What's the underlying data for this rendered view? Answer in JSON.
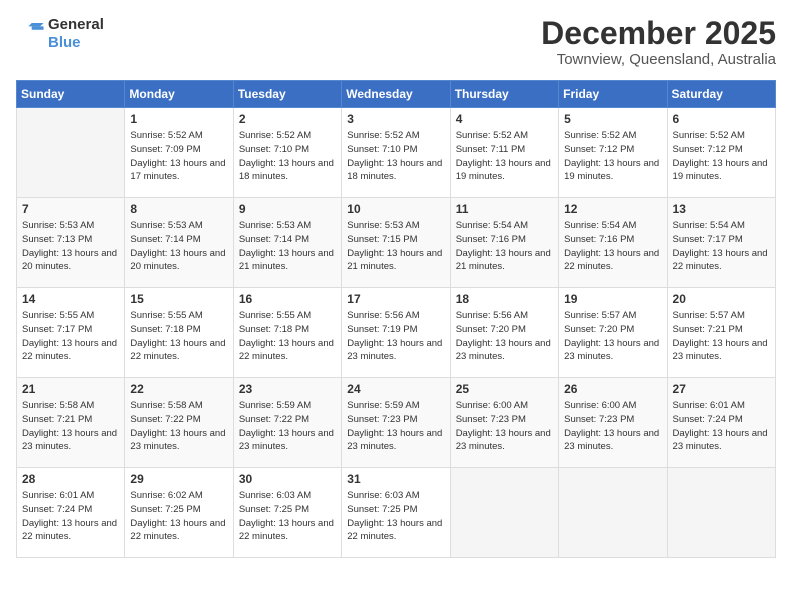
{
  "logo": {
    "general": "General",
    "blue": "Blue"
  },
  "header": {
    "month": "December 2025",
    "location": "Townview, Queensland, Australia"
  },
  "days_of_week": [
    "Sunday",
    "Monday",
    "Tuesday",
    "Wednesday",
    "Thursday",
    "Friday",
    "Saturday"
  ],
  "weeks": [
    [
      {
        "day": "",
        "sunrise": "",
        "sunset": "",
        "daylight": ""
      },
      {
        "day": "1",
        "sunrise": "Sunrise: 5:52 AM",
        "sunset": "Sunset: 7:09 PM",
        "daylight": "Daylight: 13 hours and 17 minutes."
      },
      {
        "day": "2",
        "sunrise": "Sunrise: 5:52 AM",
        "sunset": "Sunset: 7:10 PM",
        "daylight": "Daylight: 13 hours and 18 minutes."
      },
      {
        "day": "3",
        "sunrise": "Sunrise: 5:52 AM",
        "sunset": "Sunset: 7:10 PM",
        "daylight": "Daylight: 13 hours and 18 minutes."
      },
      {
        "day": "4",
        "sunrise": "Sunrise: 5:52 AM",
        "sunset": "Sunset: 7:11 PM",
        "daylight": "Daylight: 13 hours and 19 minutes."
      },
      {
        "day": "5",
        "sunrise": "Sunrise: 5:52 AM",
        "sunset": "Sunset: 7:12 PM",
        "daylight": "Daylight: 13 hours and 19 minutes."
      },
      {
        "day": "6",
        "sunrise": "Sunrise: 5:52 AM",
        "sunset": "Sunset: 7:12 PM",
        "daylight": "Daylight: 13 hours and 19 minutes."
      }
    ],
    [
      {
        "day": "7",
        "sunrise": "Sunrise: 5:53 AM",
        "sunset": "Sunset: 7:13 PM",
        "daylight": "Daylight: 13 hours and 20 minutes."
      },
      {
        "day": "8",
        "sunrise": "Sunrise: 5:53 AM",
        "sunset": "Sunset: 7:14 PM",
        "daylight": "Daylight: 13 hours and 20 minutes."
      },
      {
        "day": "9",
        "sunrise": "Sunrise: 5:53 AM",
        "sunset": "Sunset: 7:14 PM",
        "daylight": "Daylight: 13 hours and 21 minutes."
      },
      {
        "day": "10",
        "sunrise": "Sunrise: 5:53 AM",
        "sunset": "Sunset: 7:15 PM",
        "daylight": "Daylight: 13 hours and 21 minutes."
      },
      {
        "day": "11",
        "sunrise": "Sunrise: 5:54 AM",
        "sunset": "Sunset: 7:16 PM",
        "daylight": "Daylight: 13 hours and 21 minutes."
      },
      {
        "day": "12",
        "sunrise": "Sunrise: 5:54 AM",
        "sunset": "Sunset: 7:16 PM",
        "daylight": "Daylight: 13 hours and 22 minutes."
      },
      {
        "day": "13",
        "sunrise": "Sunrise: 5:54 AM",
        "sunset": "Sunset: 7:17 PM",
        "daylight": "Daylight: 13 hours and 22 minutes."
      }
    ],
    [
      {
        "day": "14",
        "sunrise": "Sunrise: 5:55 AM",
        "sunset": "Sunset: 7:17 PM",
        "daylight": "Daylight: 13 hours and 22 minutes."
      },
      {
        "day": "15",
        "sunrise": "Sunrise: 5:55 AM",
        "sunset": "Sunset: 7:18 PM",
        "daylight": "Daylight: 13 hours and 22 minutes."
      },
      {
        "day": "16",
        "sunrise": "Sunrise: 5:55 AM",
        "sunset": "Sunset: 7:18 PM",
        "daylight": "Daylight: 13 hours and 22 minutes."
      },
      {
        "day": "17",
        "sunrise": "Sunrise: 5:56 AM",
        "sunset": "Sunset: 7:19 PM",
        "daylight": "Daylight: 13 hours and 23 minutes."
      },
      {
        "day": "18",
        "sunrise": "Sunrise: 5:56 AM",
        "sunset": "Sunset: 7:20 PM",
        "daylight": "Daylight: 13 hours and 23 minutes."
      },
      {
        "day": "19",
        "sunrise": "Sunrise: 5:57 AM",
        "sunset": "Sunset: 7:20 PM",
        "daylight": "Daylight: 13 hours and 23 minutes."
      },
      {
        "day": "20",
        "sunrise": "Sunrise: 5:57 AM",
        "sunset": "Sunset: 7:21 PM",
        "daylight": "Daylight: 13 hours and 23 minutes."
      }
    ],
    [
      {
        "day": "21",
        "sunrise": "Sunrise: 5:58 AM",
        "sunset": "Sunset: 7:21 PM",
        "daylight": "Daylight: 13 hours and 23 minutes."
      },
      {
        "day": "22",
        "sunrise": "Sunrise: 5:58 AM",
        "sunset": "Sunset: 7:22 PM",
        "daylight": "Daylight: 13 hours and 23 minutes."
      },
      {
        "day": "23",
        "sunrise": "Sunrise: 5:59 AM",
        "sunset": "Sunset: 7:22 PM",
        "daylight": "Daylight: 13 hours and 23 minutes."
      },
      {
        "day": "24",
        "sunrise": "Sunrise: 5:59 AM",
        "sunset": "Sunset: 7:23 PM",
        "daylight": "Daylight: 13 hours and 23 minutes."
      },
      {
        "day": "25",
        "sunrise": "Sunrise: 6:00 AM",
        "sunset": "Sunset: 7:23 PM",
        "daylight": "Daylight: 13 hours and 23 minutes."
      },
      {
        "day": "26",
        "sunrise": "Sunrise: 6:00 AM",
        "sunset": "Sunset: 7:23 PM",
        "daylight": "Daylight: 13 hours and 23 minutes."
      },
      {
        "day": "27",
        "sunrise": "Sunrise: 6:01 AM",
        "sunset": "Sunset: 7:24 PM",
        "daylight": "Daylight: 13 hours and 23 minutes."
      }
    ],
    [
      {
        "day": "28",
        "sunrise": "Sunrise: 6:01 AM",
        "sunset": "Sunset: 7:24 PM",
        "daylight": "Daylight: 13 hours and 22 minutes."
      },
      {
        "day": "29",
        "sunrise": "Sunrise: 6:02 AM",
        "sunset": "Sunset: 7:25 PM",
        "daylight": "Daylight: 13 hours and 22 minutes."
      },
      {
        "day": "30",
        "sunrise": "Sunrise: 6:03 AM",
        "sunset": "Sunset: 7:25 PM",
        "daylight": "Daylight: 13 hours and 22 minutes."
      },
      {
        "day": "31",
        "sunrise": "Sunrise: 6:03 AM",
        "sunset": "Sunset: 7:25 PM",
        "daylight": "Daylight: 13 hours and 22 minutes."
      },
      {
        "day": "",
        "sunrise": "",
        "sunset": "",
        "daylight": ""
      },
      {
        "day": "",
        "sunrise": "",
        "sunset": "",
        "daylight": ""
      },
      {
        "day": "",
        "sunrise": "",
        "sunset": "",
        "daylight": ""
      }
    ]
  ]
}
